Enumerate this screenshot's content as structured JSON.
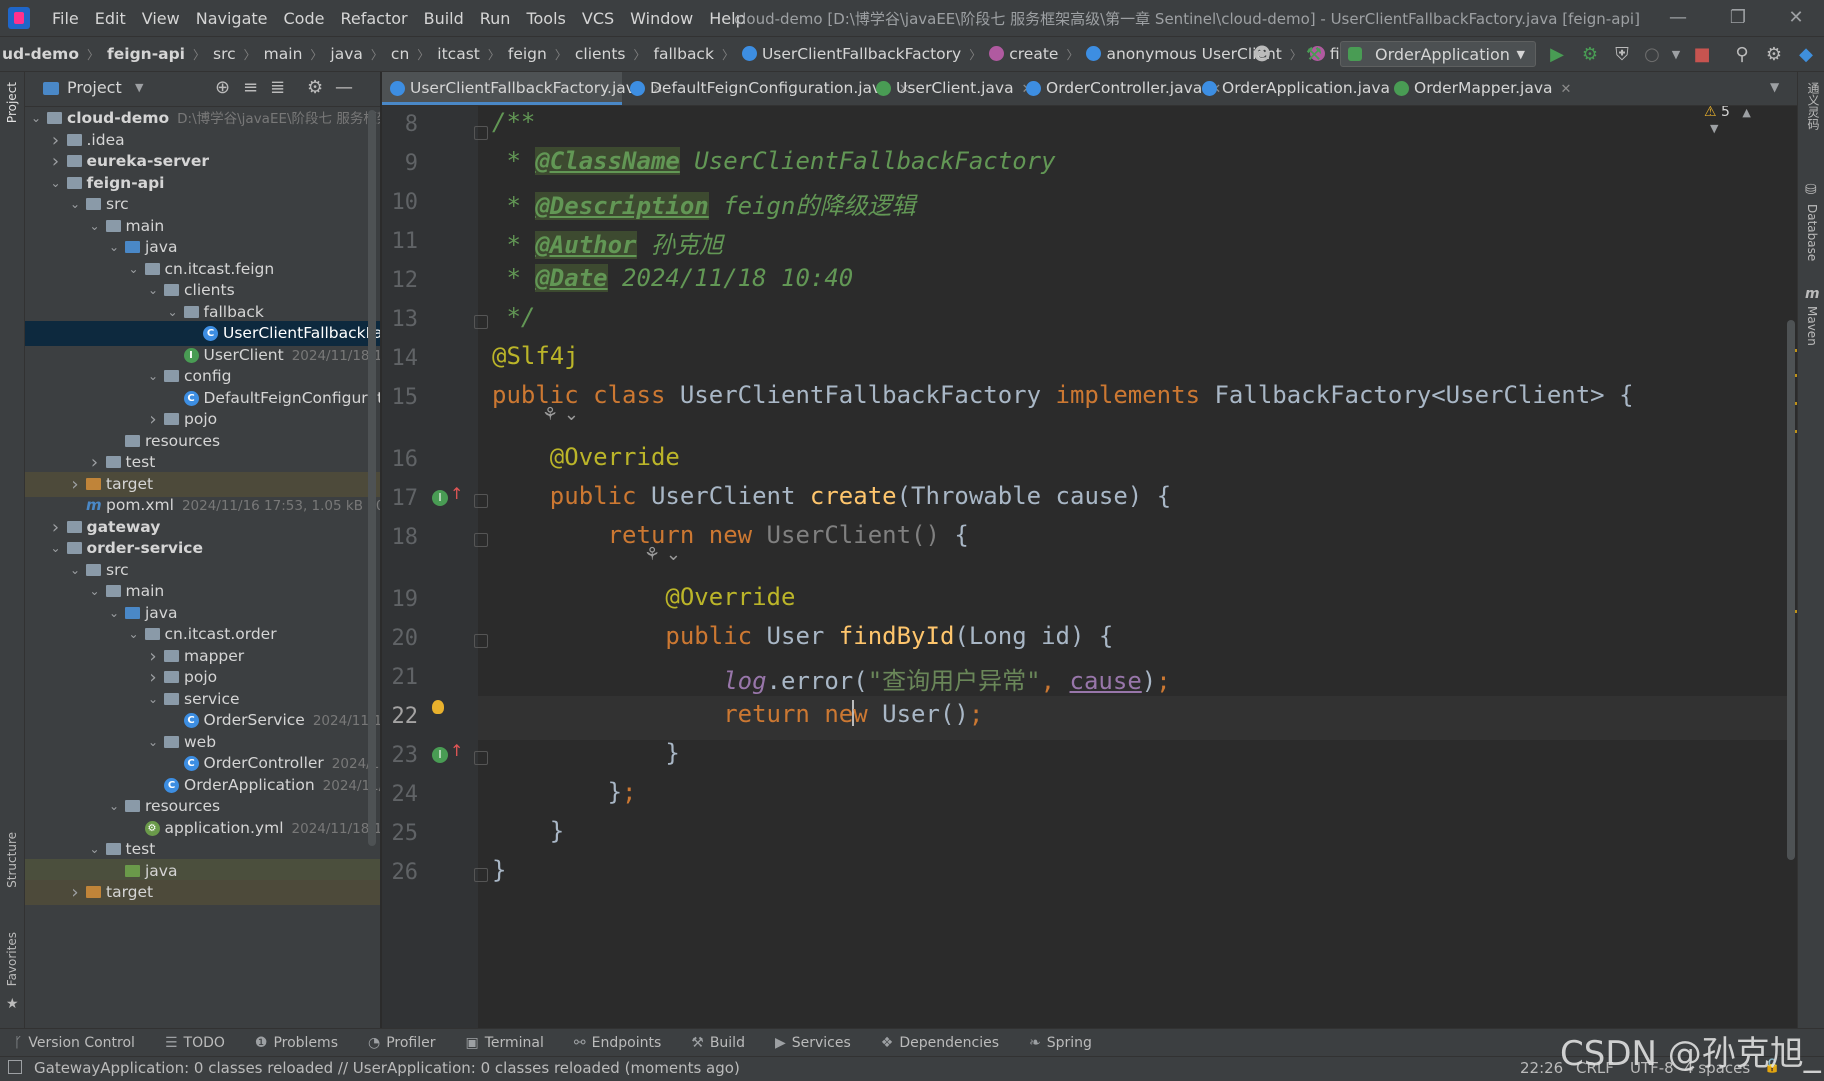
{
  "menu": [
    "File",
    "Edit",
    "View",
    "Navigate",
    "Code",
    "Refactor",
    "Build",
    "Run",
    "Tools",
    "VCS",
    "Window",
    "Help"
  ],
  "window_title": "cloud-demo [D:\\博学谷\\javaEE\\阶段七 服务框架高级\\第一章 Sentinel\\cloud-demo] - UserClientFallbackFactory.java [feign-api]",
  "breadcrumbs": [
    "ud-demo",
    "feign-api",
    "src",
    "main",
    "java",
    "cn",
    "itcast",
    "feign",
    "clients",
    "fallback",
    "UserClientFallbackFactory",
    "create",
    "anonymous UserClient",
    "findById"
  ],
  "run_config": "OrderApplication",
  "project": {
    "title": "Project",
    "tree": [
      {
        "label": "cloud-demo",
        "meta": "D:\\博学谷\\javaEE\\阶段七 服务框架",
        "bold": true,
        "level": 0,
        "arrow": "open",
        "icon": "module"
      },
      {
        "label": ".idea",
        "meta": "",
        "level": 1,
        "arrow": "closed",
        "icon": "folder"
      },
      {
        "label": "eureka-server",
        "meta": "",
        "bold": true,
        "level": 1,
        "arrow": "closed",
        "icon": "module"
      },
      {
        "label": "feign-api",
        "meta": "",
        "bold": true,
        "level": 1,
        "arrow": "open",
        "icon": "module"
      },
      {
        "label": "src",
        "meta": "",
        "level": 2,
        "arrow": "open",
        "icon": "folder"
      },
      {
        "label": "main",
        "meta": "",
        "level": 3,
        "arrow": "open",
        "icon": "folder"
      },
      {
        "label": "java",
        "meta": "",
        "level": 4,
        "arrow": "open",
        "icon": "src"
      },
      {
        "label": "cn.itcast.feign",
        "meta": "",
        "level": 5,
        "arrow": "open",
        "icon": "package"
      },
      {
        "label": "clients",
        "meta": "",
        "level": 6,
        "arrow": "open",
        "icon": "package"
      },
      {
        "label": "fallback",
        "meta": "",
        "level": 7,
        "arrow": "open",
        "icon": "package"
      },
      {
        "label": "UserClientFallbackFa",
        "meta": "",
        "level": 8,
        "arrow": "",
        "icon": "class",
        "selected": true
      },
      {
        "label": "UserClient",
        "meta": "2024/11/18 1",
        "level": 7,
        "arrow": "",
        "icon": "interface"
      },
      {
        "label": "config",
        "meta": "",
        "level": 6,
        "arrow": "open",
        "icon": "package"
      },
      {
        "label": "DefaultFeignConfigurati",
        "meta": "",
        "level": 7,
        "arrow": "",
        "icon": "class"
      },
      {
        "label": "pojo",
        "meta": "",
        "level": 6,
        "arrow": "closed",
        "icon": "package"
      },
      {
        "label": "resources",
        "meta": "",
        "level": 4,
        "arrow": "",
        "icon": "res"
      },
      {
        "label": "test",
        "meta": "",
        "level": 3,
        "arrow": "closed",
        "icon": "folder"
      },
      {
        "label": "target",
        "meta": "",
        "level": 2,
        "arrow": "closed",
        "icon": "target",
        "target": true
      },
      {
        "label": "pom.xml",
        "meta": "2024/11/16 17:53, 1.05 kB 2024/",
        "level": 2,
        "arrow": "",
        "icon": "maven"
      },
      {
        "label": "gateway",
        "meta": "",
        "bold": true,
        "level": 1,
        "arrow": "closed",
        "icon": "module"
      },
      {
        "label": "order-service",
        "meta": "",
        "bold": true,
        "level": 1,
        "arrow": "open",
        "icon": "module"
      },
      {
        "label": "src",
        "meta": "",
        "level": 2,
        "arrow": "open",
        "icon": "folder"
      },
      {
        "label": "main",
        "meta": "",
        "level": 3,
        "arrow": "open",
        "icon": "folder"
      },
      {
        "label": "java",
        "meta": "",
        "level": 4,
        "arrow": "open",
        "icon": "src"
      },
      {
        "label": "cn.itcast.order",
        "meta": "",
        "level": 5,
        "arrow": "open",
        "icon": "package"
      },
      {
        "label": "mapper",
        "meta": "",
        "level": 6,
        "arrow": "closed",
        "icon": "package"
      },
      {
        "label": "pojo",
        "meta": "",
        "level": 6,
        "arrow": "closed",
        "icon": "package"
      },
      {
        "label": "service",
        "meta": "",
        "level": 6,
        "arrow": "open",
        "icon": "package"
      },
      {
        "label": "OrderService",
        "meta": "2024/11/1",
        "level": 7,
        "arrow": "",
        "icon": "class"
      },
      {
        "label": "web",
        "meta": "",
        "level": 6,
        "arrow": "open",
        "icon": "package"
      },
      {
        "label": "OrderController",
        "meta": "2024/1",
        "level": 7,
        "arrow": "",
        "icon": "class"
      },
      {
        "label": "OrderApplication",
        "meta": "2024/11/",
        "level": 6,
        "arrow": "",
        "icon": "app"
      },
      {
        "label": "resources",
        "meta": "",
        "level": 4,
        "arrow": "open",
        "icon": "res"
      },
      {
        "label": "application.yml",
        "meta": "2024/11/18 10:",
        "level": 5,
        "arrow": "",
        "icon": "yml"
      },
      {
        "label": "test",
        "meta": "",
        "level": 3,
        "arrow": "open",
        "icon": "folder"
      },
      {
        "label": "java",
        "meta": "",
        "level": 4,
        "arrow": "",
        "icon": "testsrc",
        "hl": true
      },
      {
        "label": "target",
        "meta": "",
        "level": 2,
        "arrow": "closed",
        "icon": "target",
        "target": true
      }
    ]
  },
  "tabs": [
    {
      "label": "UserClientFallbackFactory.java",
      "active": true,
      "icon": "class"
    },
    {
      "label": "DefaultFeignConfiguration.java",
      "active": false,
      "icon": "class"
    },
    {
      "label": "UserClient.java",
      "active": false,
      "icon": "interface"
    },
    {
      "label": "OrderController.java",
      "active": false,
      "icon": "class"
    },
    {
      "label": "OrderApplication.java",
      "active": false,
      "icon": "app"
    },
    {
      "label": "OrderMapper.java",
      "active": false,
      "icon": "interface"
    }
  ],
  "inspections": "5",
  "editor": {
    "current_line": 22,
    "lines": [
      {
        "n": "8",
        "html": "<span class=\"doc\">/**</span>"
      },
      {
        "n": "9",
        "html": "<span class=\"doc\"> * </span><span class=\"doctag\">@ClassName</span><span class=\"doc\"> UserClientFallbackFactory</span>"
      },
      {
        "n": "10",
        "html": "<span class=\"doc\"> * </span><span class=\"doctag\">@Description</span><span class=\"doc\"> feign的降级逻辑</span>"
      },
      {
        "n": "11",
        "html": "<span class=\"doc\"> * </span><span class=\"doctag\">@Author</span><span class=\"doc\"> 孙克旭</span>"
      },
      {
        "n": "12",
        "html": "<span class=\"doc\"> * </span><span class=\"doctag\">@Date</span><span class=\"doc\"> 2024/11/18 10:40</span>"
      },
      {
        "n": "13",
        "html": "<span class=\"doc\"> */</span>"
      },
      {
        "n": "14",
        "html": "<span class=\"ann\">@Slf4j</span>"
      },
      {
        "n": "15",
        "html": "<span class=\"kw\">public class </span>UserClientFallbackFactory <span class=\"kw\">implements </span>FallbackFactory&lt;UserClient&gt; {"
      },
      {
        "n": "16",
        "html": "    <span class=\"ann\">@Override</span>"
      },
      {
        "n": "17",
        "html": "    <span class=\"kw\">public </span>UserClient <span class=\"fn\">create</span>(Throwable cause) {"
      },
      {
        "n": "18",
        "html": "        <span class=\"kw\">return new </span><span class=\"grey\">UserClient()</span> {"
      },
      {
        "n": "19",
        "html": "            <span class=\"ann\">@Override</span>"
      },
      {
        "n": "20",
        "html": "            <span class=\"kw\">public </span>User <span class=\"fn\">findById</span>(Long id) {"
      },
      {
        "n": "21",
        "html": "                <span class=\"logv\">log</span>.error(<span class=\"str\">\"查询用户异常\"</span><span class=\"kw\">, </span><span class=\"param\">cause</span>)<span class=\"kw\">;</span>"
      },
      {
        "n": "22",
        "html": "                <span class=\"kw\">return ne</span><span class=\"caret\"></span><span class=\"kw\">w </span>User()<span class=\"kw\">;</span>"
      },
      {
        "n": "23",
        "html": "            }"
      },
      {
        "n": "24",
        "html": "        }<span class=\"kw\">;</span>"
      },
      {
        "n": "25",
        "html": "    }"
      },
      {
        "n": "26",
        "html": "}"
      }
    ]
  },
  "toolwindows": [
    {
      "icon": "branch-icon",
      "glyph": "ᚴ",
      "label": "Version Control"
    },
    {
      "icon": "todo-icon",
      "glyph": "☰",
      "label": "TODO"
    },
    {
      "icon": "problems-icon",
      "glyph": "❶",
      "label": "Problems"
    },
    {
      "icon": "profiler-icon",
      "glyph": "◔",
      "label": "Profiler"
    },
    {
      "icon": "terminal-icon",
      "glyph": "▣",
      "label": "Terminal"
    },
    {
      "icon": "endpoints-icon",
      "glyph": "⚯",
      "label": "Endpoints"
    },
    {
      "icon": "build-icon",
      "glyph": "⚒",
      "label": "Build"
    },
    {
      "icon": "services-icon",
      "glyph": "▶",
      "label": "Services"
    },
    {
      "icon": "dependencies-icon",
      "glyph": "❖",
      "label": "Dependencies"
    },
    {
      "icon": "spring-icon",
      "glyph": "❧",
      "label": "Spring"
    }
  ],
  "status": {
    "message": "GatewayApplication: 0 classes reloaded // UserApplication: 0 classes reloaded (moments ago)",
    "position": "22:26",
    "line_sep": "CRLF",
    "encoding": "UTF-8",
    "indent": "4 spaces"
  },
  "side_labels": {
    "project": "Project",
    "structure": "Structure",
    "favorites": "Favorites",
    "right_top": "通义灵码",
    "database": "Database",
    "maven": "Maven"
  },
  "watermark": "CSDN @孙克旭_",
  "colors": {
    "accent": "#4a88c7",
    "selection": "#0d293e",
    "keyword": "#cc7832",
    "annotation": "#bbb529",
    "string": "#6a8759",
    "doc": "#629755",
    "function": "#ffc66d"
  }
}
